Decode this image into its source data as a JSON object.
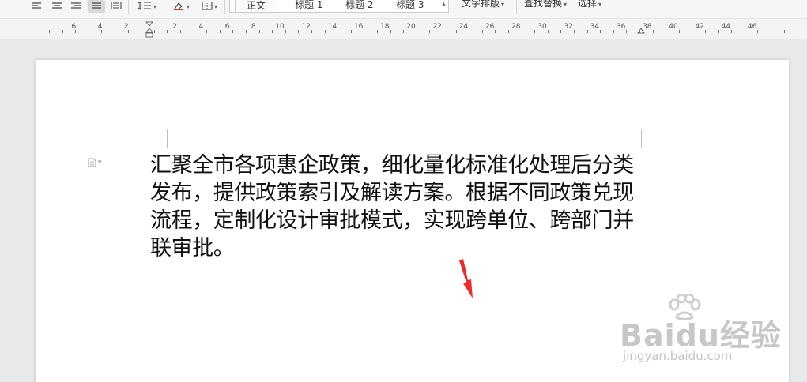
{
  "toolbar": {
    "style_gallery": [
      "正文",
      "标题 1",
      "标题 2",
      "标题 3"
    ],
    "text_layout_label": "文字排版",
    "find_replace_label": "查找替换",
    "select_label": "选择"
  },
  "ruler": {
    "labels": [
      "6",
      "4",
      "2",
      "2",
      "4",
      "6",
      "8",
      "10",
      "12",
      "14",
      "16",
      "18",
      "20",
      "22",
      "24",
      "26",
      "28",
      "30",
      "32",
      "34",
      "36",
      "38",
      "40",
      "42",
      "44",
      "46"
    ]
  },
  "document": {
    "paragraph": "汇聚全市各项惠企政策，细化量化标准化处理后分类发布，提供政策索引及解读方案。根据不同政策兑现流程，定制化设计审批模式，实现跨单位、跨部门并联审批。"
  },
  "watermark": {
    "brand": "Baidu经验",
    "url": "jingyan.baidu.com"
  },
  "colors": {
    "arrow": "#ee2a2a",
    "page_background": "#ffffff",
    "workspace": "#e8e9eb"
  }
}
